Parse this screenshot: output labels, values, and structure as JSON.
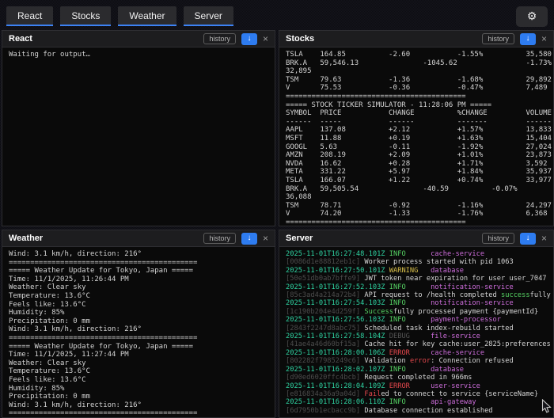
{
  "topbar": {
    "tabs": [
      {
        "label": "React"
      },
      {
        "label": "Stocks"
      },
      {
        "label": "Weather"
      },
      {
        "label": "Server"
      }
    ],
    "gear_icon": "⚙"
  },
  "panel_controls": {
    "history_label": "history",
    "download_icon": "↓",
    "close_icon": "×"
  },
  "panels": {
    "react": {
      "title": "React",
      "lines": [
        "Waiting for output…"
      ]
    },
    "stocks": {
      "title": "Stocks",
      "lines": [
        "TSLA\t164.85\t\t-2.60\t\t-1.55%\t\t35,580",
        "BRK.A\t59,546.13\t\t-1045.62\t\t-1.73%",
        "32,895",
        "TSM\t79.63\t\t-1.36\t\t-1.68%\t\t29,892",
        "V\t75.53\t\t-0.36\t\t-0.47%\t\t7,489",
        "==========================================",
        "===== STOCK TICKER SIMULATOR - 11:28:06 PM =====",
        "SYMBOL\tPRICE\t\tCHANGE\t\t%CHANGE\t\tVOLUME",
        "------\t-----\t\t------\t\t-------\t\t------",
        "AAPL\t137.08\t\t+2.12\t\t+1.57%\t\t13,833",
        "MSFT\t11.88\t\t+0.19\t\t+1.63%\t\t15,404",
        "GOOGL\t5.63\t\t-0.11\t\t-1.92%\t\t27,024",
        "AMZN\t208.19\t\t+2.09\t\t+1.01%\t\t23,873",
        "NVDA\t16.62\t\t+0.28\t\t+1.71%\t\t3,592",
        "META\t331.22\t\t+5.97\t\t+1.84%\t\t35,937",
        "TSLA\t166.07\t\t+1.22\t\t+0.74%\t\t33,977",
        "BRK.A\t59,505.54\t\t-40.59\t\t-0.07%",
        "36,088",
        "TSM\t78.71\t\t-0.92\t\t-1.16%\t\t24,297",
        "V\t74.20\t\t-1.33\t\t-1.76%\t\t6,368",
        "=========================================="
      ]
    },
    "weather": {
      "title": "Weather",
      "lines": [
        "Wind: 3.1 km/h, direction: 216°",
        "============================================",
        "===== Weather Update for Tokyo, Japan =====",
        "Time: 11/1/2025, 11:26:44 PM",
        "Weather: Clear sky",
        "Temperature: 13.6°C",
        "Feels like: 13.6°C",
        "Humidity: 85%",
        "Precipitation: 0 mm",
        "Wind: 3.1 km/h, direction: 216°",
        "============================================",
        "===== Weather Update for Tokyo, Japan =====",
        "Time: 11/1/2025, 11:27:44 PM",
        "Weather: Clear sky",
        "Temperature: 13.6°C",
        "Feels like: 13.6°C",
        "Humidity: 85%",
        "Precipitation: 0 mm",
        "Wind: 3.1 km/h, direction: 216°",
        "============================================"
      ]
    },
    "server": {
      "title": "Server",
      "logs": [
        {
          "ts": "2025-11-01T16:27:48.101Z",
          "level": "INFO",
          "service": "cache-service",
          "id": "0086d1e88812eb1c",
          "msg": [
            [
              "Worker process started with pid 1063",
              ""
            ]
          ]
        },
        {
          "ts": "2025-11-01T16:27:50.101Z",
          "level": "WARNING",
          "service": "database",
          "id": "50e51db0ab7bffe9",
          "msg": [
            [
              "JWT token near expiration for user user_7047",
              ""
            ]
          ]
        },
        {
          "ts": "2025-11-01T16:27:52.103Z",
          "level": "INFO",
          "service": "notification-service",
          "id": "85c3ad4a214a72b4",
          "msg": [
            [
              "API request to /health completed ",
              ""
            ],
            [
              "success",
              "g"
            ],
            [
              "fully",
              ""
            ]
          ]
        },
        {
          "ts": "2025-11-01T16:27:54.103Z",
          "level": "INFO",
          "service": "notification-service",
          "id": "1c190b204e4d259f",
          "msg": [
            [
              "Success",
              "g"
            ],
            [
              "fully processed payment {paymentId}",
              ""
            ]
          ]
        },
        {
          "ts": "2025-11-01T16:27:56.103Z",
          "level": "INFO",
          "service": "payment-processor",
          "id": "2843f2247d8abc75",
          "msg": [
            [
              "Scheduled task index-rebuild started",
              ""
            ]
          ]
        },
        {
          "ts": "2025-11-01T16:27:58.104Z",
          "level": "DEBUG",
          "service": "file-service",
          "id": "41ae4a46d60bf15a",
          "msg": [
            [
              "Cache hit for key cache:user_2825:preferences",
              ""
            ]
          ]
        },
        {
          "ts": "2025-11-01T16:28:00.106Z",
          "level": "ERROR",
          "service": "cache-service",
          "id": "802282f7985249c6",
          "msg": [
            [
              "Validation ",
              ""
            ],
            [
              "error",
              "r"
            ],
            [
              ": Connection refused",
              ""
            ]
          ]
        },
        {
          "ts": "2025-11-01T16:28:02.107Z",
          "level": "INFO",
          "service": "database",
          "id": "d90ed6020ffc4bcb",
          "msg": [
            [
              "Request completed in 966ms",
              ""
            ]
          ]
        },
        {
          "ts": "2025-11-01T16:28:04.109Z",
          "level": "ERROR",
          "service": "user-service",
          "id": "e816834a36a9a04d",
          "msg": [
            [
              "Fail",
              "r"
            ],
            [
              "ed to connect to service {serviceName}",
              ""
            ]
          ]
        },
        {
          "ts": "2025-11-01T16:28:06.110Z",
          "level": "INFO",
          "service": "api-gateway",
          "id": "6d7950b1ecbacc9b",
          "msg": [
            [
              "Database connection established",
              ""
            ]
          ]
        }
      ]
    }
  },
  "colors": {
    "accent_blue": "#2e7cf0",
    "tab_underline": "#3c82f5",
    "timestamp_green": "#2fd3a2",
    "info_green": "#56d364",
    "warning_yellow": "#d9c04b",
    "error_red": "#e5484d",
    "debug_gray": "#545454",
    "service_magenta": "#cd6ddb",
    "panel_text": "#d4d4d4"
  }
}
